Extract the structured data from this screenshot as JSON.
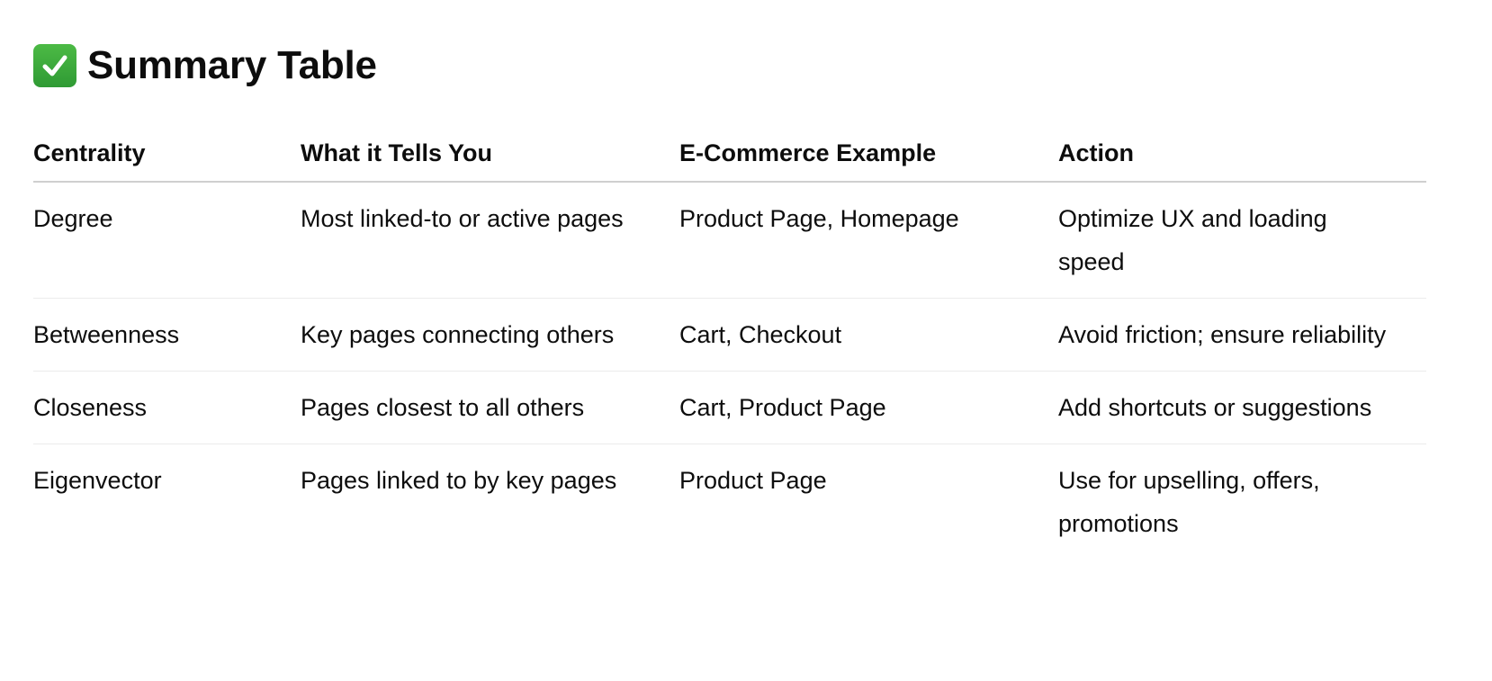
{
  "heading": {
    "icon": "check-mark-button-icon",
    "icon_glyph": "✔",
    "title": "Summary Table"
  },
  "table": {
    "headers": [
      "Centrality",
      "What it Tells You",
      "E-Commerce Example",
      "Action"
    ],
    "rows": [
      [
        "Degree",
        "Most linked-to or active pages",
        "Product Page, Homepage",
        "Optimize UX and loading speed"
      ],
      [
        "Betweenness",
        "Key pages connecting others",
        "Cart, Checkout",
        "Avoid friction; ensure reliability"
      ],
      [
        "Closeness",
        "Pages closest to all others",
        "Cart, Product Page",
        "Add shortcuts or suggestions"
      ],
      [
        "Eigenvector",
        "Pages linked to by key pages",
        "Product Page",
        "Use for upselling, offers, promotions"
      ]
    ]
  },
  "colors": {
    "icon_background": "#3ba33b",
    "text": "#0d0d0d",
    "header_rule": "#cfcfcf",
    "row_rule": "#ececec"
  }
}
